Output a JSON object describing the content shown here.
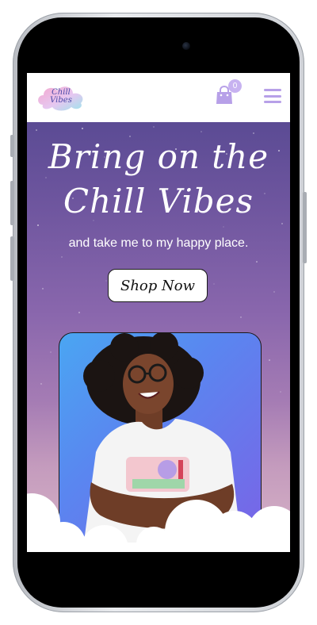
{
  "header": {
    "logo_line1": "Chill",
    "logo_line2": "Vibes",
    "cart_count": "0"
  },
  "hero": {
    "title_line1": "Bring on the",
    "title_line2": "Chill Vibes",
    "subtitle": "and take me to my happy place.",
    "shop_button_label": "Shop Now"
  },
  "colors": {
    "accent": "#b7a0e8",
    "hero_top": "#5b4b94",
    "hero_bottom": "#d8b4c7",
    "photo_bg": "#5a86f0"
  },
  "icons": {
    "cart": "shopping-bag-icon",
    "menu": "hamburger-menu-icon"
  }
}
